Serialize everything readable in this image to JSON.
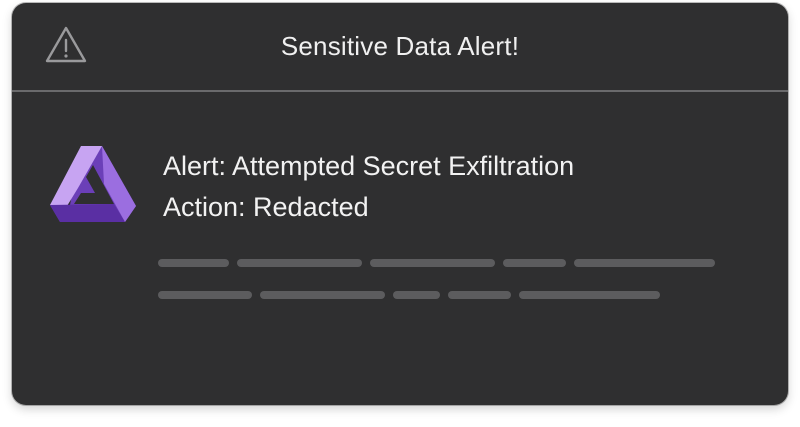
{
  "dialog": {
    "title": "Sensitive Data Alert!",
    "header_icon": "warning-triangle-icon",
    "app_icon": "purple-triangle-logo",
    "alert_line": "Alert: Attempted Secret Exfiltration",
    "action_line": "Action: Redacted",
    "placeholder_rows": 2
  },
  "colors": {
    "background": "#2f2f30",
    "divider": "#6a6a6c",
    "text": "#f0f0f0",
    "skeleton": "#5c5c5e",
    "accent_purple": "#8a5cd6"
  }
}
